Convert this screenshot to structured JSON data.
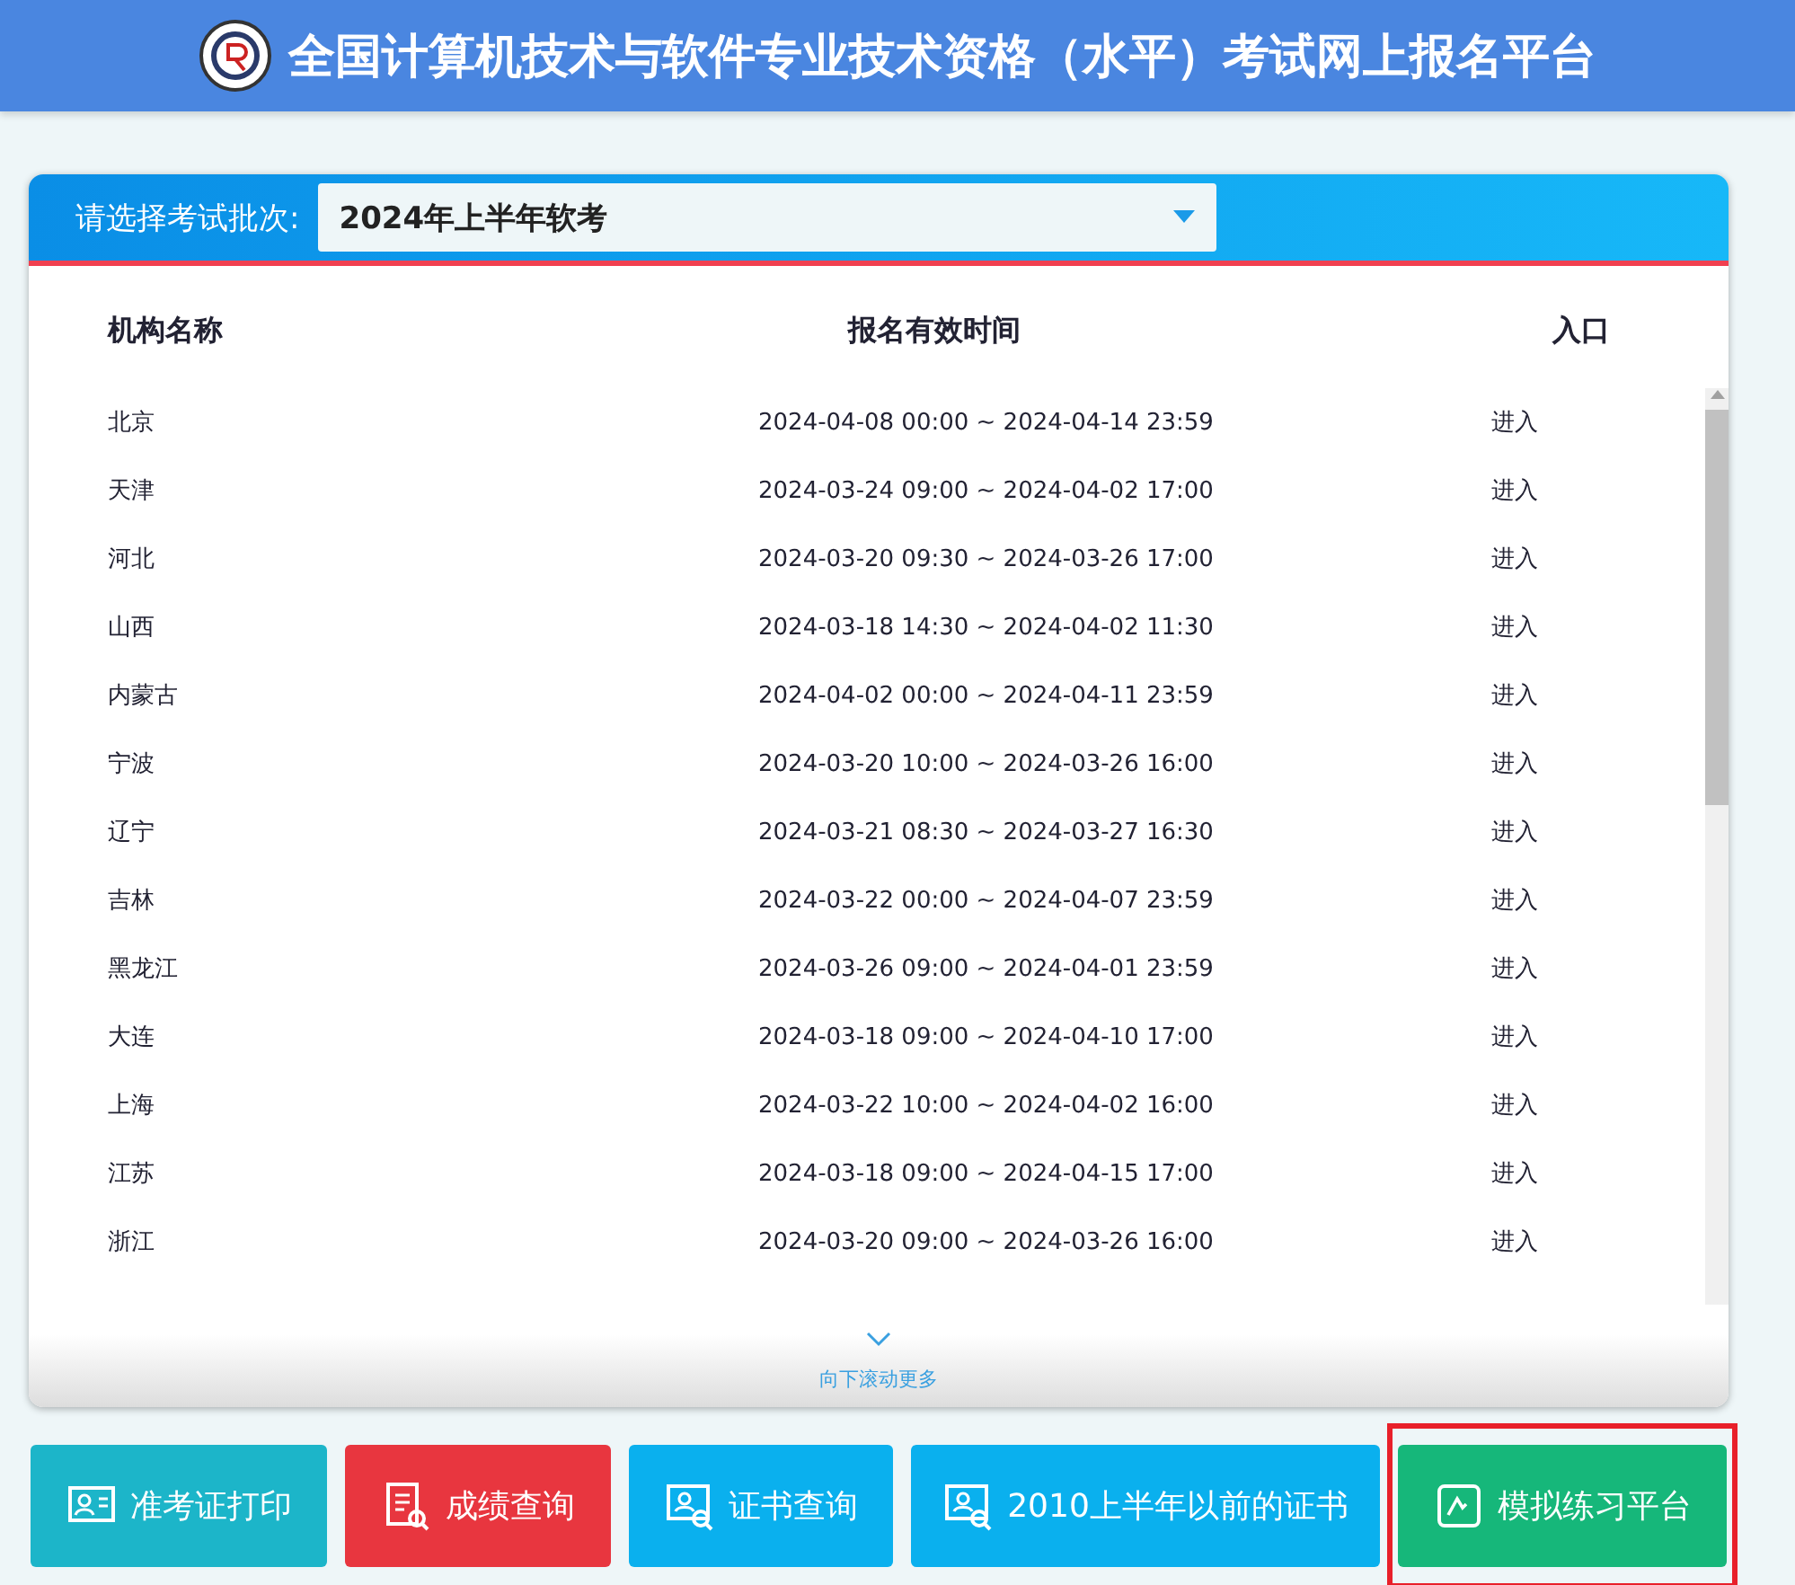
{
  "header": {
    "title": "全国计算机技术与软件专业技术资格（水平）考试网上报名平台"
  },
  "batch_select": {
    "label": "请选择考试批次:",
    "value": "2024年上半年软考"
  },
  "table": {
    "columns": [
      "机构名称",
      "报名有效时间",
      "入口"
    ],
    "rows": [
      {
        "name": "北京",
        "period": "2024-04-08 00:00 ~ 2024-04-14 23:59",
        "entry": "进入"
      },
      {
        "name": "天津",
        "period": "2024-03-24 09:00 ~ 2024-04-02 17:00",
        "entry": "进入"
      },
      {
        "name": "河北",
        "period": "2024-03-20 09:30 ~ 2024-03-26 17:00",
        "entry": "进入"
      },
      {
        "name": "山西",
        "period": "2024-03-18 14:30 ~ 2024-04-02 11:30",
        "entry": "进入"
      },
      {
        "name": "内蒙古",
        "period": "2024-04-02 00:00 ~ 2024-04-11 23:59",
        "entry": "进入"
      },
      {
        "name": "宁波",
        "period": "2024-03-20 10:00 ~ 2024-03-26 16:00",
        "entry": "进入"
      },
      {
        "name": "辽宁",
        "period": "2024-03-21 08:30 ~ 2024-03-27 16:30",
        "entry": "进入"
      },
      {
        "name": "吉林",
        "period": "2024-03-22 00:00 ~ 2024-04-07 23:59",
        "entry": "进入"
      },
      {
        "name": "黑龙江",
        "period": "2024-03-26 09:00 ~ 2024-04-01 23:59",
        "entry": "进入"
      },
      {
        "name": "大连",
        "period": "2024-03-18 09:00 ~ 2024-04-10 17:00",
        "entry": "进入"
      },
      {
        "name": "上海",
        "period": "2024-03-22 10:00 ~ 2024-04-02 16:00",
        "entry": "进入"
      },
      {
        "name": "江苏",
        "period": "2024-03-18 09:00 ~ 2024-04-15 17:00",
        "entry": "进入"
      },
      {
        "name": "浙江",
        "period": "2024-03-20 09:00 ~ 2024-03-26 16:00",
        "entry": "进入"
      }
    ],
    "scroll_hint": "向下滚动更多"
  },
  "buttons": [
    {
      "label": "准考证打印",
      "kind": "card",
      "color": "#1cb5c9",
      "highlighted": false
    },
    {
      "label": "成绩查询",
      "kind": "report",
      "color": "#e8363f",
      "highlighted": false
    },
    {
      "label": "证书查询",
      "kind": "certificate",
      "color": "#0ab0ee",
      "highlighted": false
    },
    {
      "label": "2010上半年以前的证书",
      "kind": "certificate",
      "color": "#0ab0ee",
      "highlighted": false
    },
    {
      "label": "模拟练习平台",
      "kind": "practice",
      "color": "#16b77a",
      "highlighted": true
    }
  ]
}
